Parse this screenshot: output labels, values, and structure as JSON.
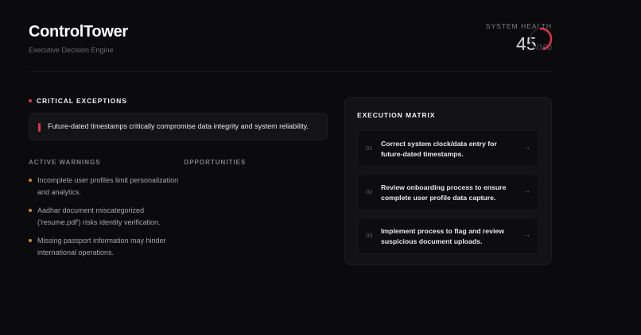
{
  "header": {
    "title": "ControlTower",
    "subtitle": "Executive Decision Engine",
    "health_label": "SYSTEM HEALTH",
    "health_value": "45",
    "health_max": "/100",
    "health_fraction": 0.45,
    "health_color": "#e0344f"
  },
  "critical": {
    "heading": "CRITICAL EXCEPTIONS",
    "items": [
      "Future-dated timestamps critically compromise data integrity and system reliability."
    ]
  },
  "warnings": {
    "heading": "ACTIVE WARNINGS",
    "items": [
      "Incomplete user profiles limit personalization and analytics.",
      "Aadhar document miscategorized ('resume.pdf') risks identity verification.",
      "Missing passport information may hinder international operations."
    ]
  },
  "opportunities": {
    "heading": "OPPORTUNITIES"
  },
  "matrix": {
    "heading": "EXECUTION MATRIX",
    "tasks": [
      {
        "num": "01",
        "text": "Correct system clock/data entry for future-dated timestamps.",
        "icon": "arrow-right-icon"
      },
      {
        "num": "02",
        "text": "Review onboarding process to ensure complete user profile data capture.",
        "icon": "arrow-right-icon"
      },
      {
        "num": "03",
        "text": "Implement process to flag and review suspicious document uploads.",
        "icon": "arrow-right-icon"
      }
    ]
  },
  "colors": {
    "background": "#0b0a0d",
    "critical_accent": "#e0344f",
    "warning_accent": "#d28a2e"
  }
}
